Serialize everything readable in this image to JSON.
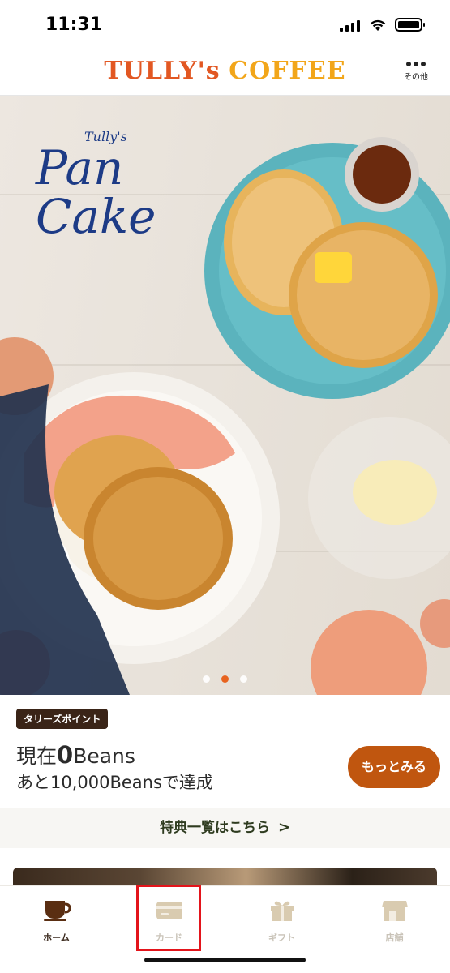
{
  "status_bar": {
    "time": "11:31"
  },
  "header": {
    "logo_part1": "TULLY's",
    "logo_part2": "COFFEE",
    "more_label": "その他"
  },
  "hero": {
    "brand_script": "Tully's",
    "title_line1": "Pan",
    "title_line2": "Cake",
    "carousel_active_index": 1,
    "carousel_count": 3
  },
  "points": {
    "badge": "タリーズポイント",
    "current_prefix": "現在",
    "current_value": "0",
    "current_unit": "Beans",
    "goal_text": "あと10,000Beansで達成",
    "more_button": "もっとみる"
  },
  "benefits": {
    "label": "特典一覧はこちら",
    "chevron": ">"
  },
  "tabs": [
    {
      "label": "ホーム",
      "icon": "coffee-cup-icon",
      "active": true
    },
    {
      "label": "カード",
      "icon": "card-icon",
      "active": false
    },
    {
      "label": "ギフト",
      "icon": "gift-icon",
      "active": false
    },
    {
      "label": "店舗",
      "icon": "store-icon",
      "active": false
    }
  ],
  "colors": {
    "brand_orange": "#e25722",
    "brand_yellow": "#f2a61a",
    "button_brown": "#c0560f",
    "badge_dark": "#3a2417",
    "highlight_red": "#e3141b",
    "tab_active": "#3b2a1e",
    "tab_inactive": "#c9c3b8"
  }
}
